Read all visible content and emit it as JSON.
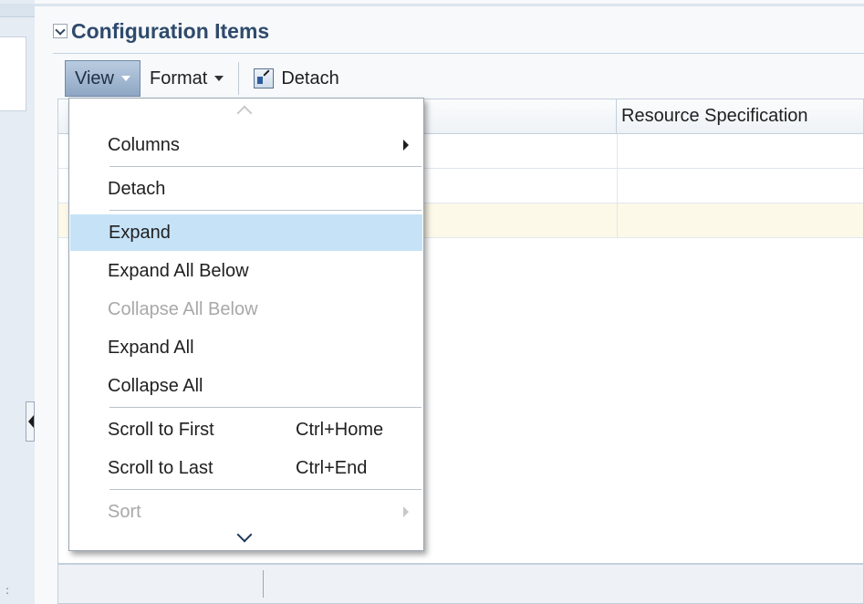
{
  "section": {
    "title": "Configuration Items"
  },
  "toolbar": {
    "view_label": "View",
    "format_label": "Format",
    "detach_label": "Detach"
  },
  "table": {
    "columns": [
      "",
      "Resource Specification"
    ]
  },
  "menu": {
    "items": [
      {
        "label": "Columns",
        "shortcut": "",
        "enabled": true,
        "submenu": true
      },
      {
        "label": "Detach",
        "shortcut": "",
        "enabled": true,
        "submenu": false
      },
      {
        "label": "Expand",
        "shortcut": "",
        "enabled": true,
        "submenu": false,
        "highlighted": true
      },
      {
        "label": "Expand All Below",
        "shortcut": "",
        "enabled": true,
        "submenu": false
      },
      {
        "label": "Collapse All Below",
        "shortcut": "",
        "enabled": false,
        "submenu": false
      },
      {
        "label": "Expand All",
        "shortcut": "",
        "enabled": true,
        "submenu": false
      },
      {
        "label": "Collapse All",
        "shortcut": "",
        "enabled": true,
        "submenu": false
      },
      {
        "label": "Scroll to First",
        "shortcut": "Ctrl+Home",
        "enabled": true,
        "submenu": false
      },
      {
        "label": "Scroll to Last",
        "shortcut": "Ctrl+End",
        "enabled": true,
        "submenu": false
      },
      {
        "label": "Sort",
        "shortcut": "",
        "enabled": false,
        "submenu": true
      }
    ]
  },
  "colors": {
    "title": "#2f4a6c",
    "menu_highlight": "#c6e2f7",
    "disabled_text": "#a8a8a8",
    "selected_row": "#fdf9e8"
  }
}
